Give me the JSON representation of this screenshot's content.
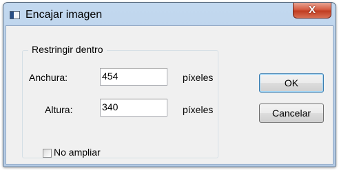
{
  "window": {
    "title": "Encajar imagen",
    "app_icon": "image-icon",
    "close_icon": "close-icon",
    "close_glyph": "X"
  },
  "group": {
    "label": "Restringir dentro",
    "width_label": "Anchura:",
    "width_value": "454",
    "width_unit": "píxeles",
    "height_label": "Altura:",
    "height_value": "340",
    "height_unit": "píxeles"
  },
  "options": {
    "no_enlarge_label": "No ampliar",
    "no_enlarge_checked": false
  },
  "buttons": {
    "ok": "OK",
    "cancel": "Cancelar"
  },
  "colors": {
    "title_bar": "#c2d8ef",
    "close_button": "#c94a2f",
    "client_bg": "#f0f0f0"
  }
}
